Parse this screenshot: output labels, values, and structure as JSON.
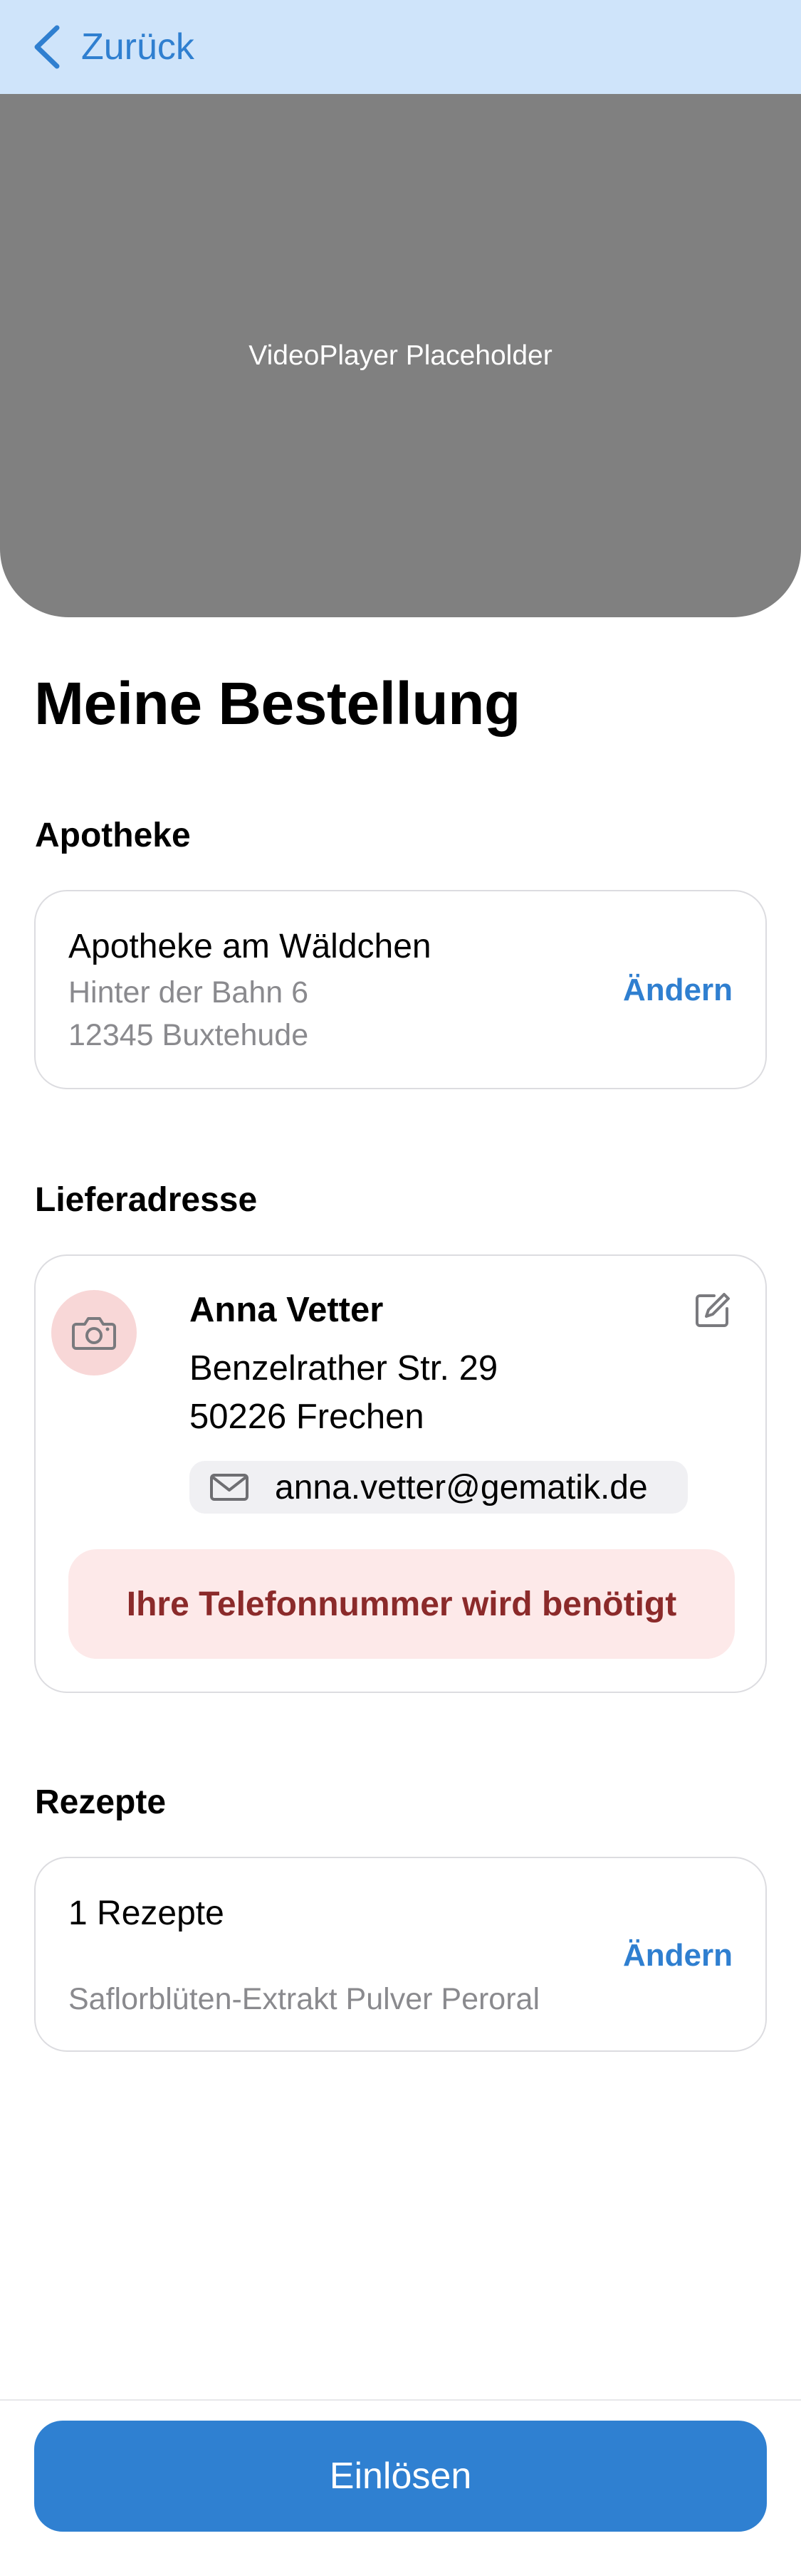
{
  "nav": {
    "back_label": "Zurück",
    "icon": "chevron-left-icon"
  },
  "video": {
    "placeholder": "VideoPlayer Placeholder"
  },
  "page": {
    "title": "Meine Bestellung"
  },
  "pharmacy": {
    "heading": "Apotheke",
    "name": "Apotheke am Wäldchen",
    "street": "Hinter der Bahn 6",
    "city": "12345 Buxtehude",
    "change_label": "Ändern"
  },
  "delivery": {
    "heading": "Lieferadresse",
    "name": "Anna Vetter",
    "street": "Benzelrather Str. 29",
    "city": "50226  Frechen",
    "email": "anna.vetter@gematik.de",
    "warning": "Ihre Telefonnummer wird benötigt",
    "icons": [
      "camera-icon",
      "edit-icon",
      "envelope-icon"
    ]
  },
  "prescriptions": {
    "heading": "Rezepte",
    "count_label": "1 Rezepte",
    "item": "Saflorblüten-Extrakt Pulver Peroral",
    "change_label": "Ändern"
  },
  "footer": {
    "submit_label": "Einlösen"
  },
  "colors": {
    "accent": "#2f80d1",
    "navbar_bg": "#cfe4fa",
    "warning_bg": "#fde9e9",
    "warning_text": "#8b2a2a"
  }
}
